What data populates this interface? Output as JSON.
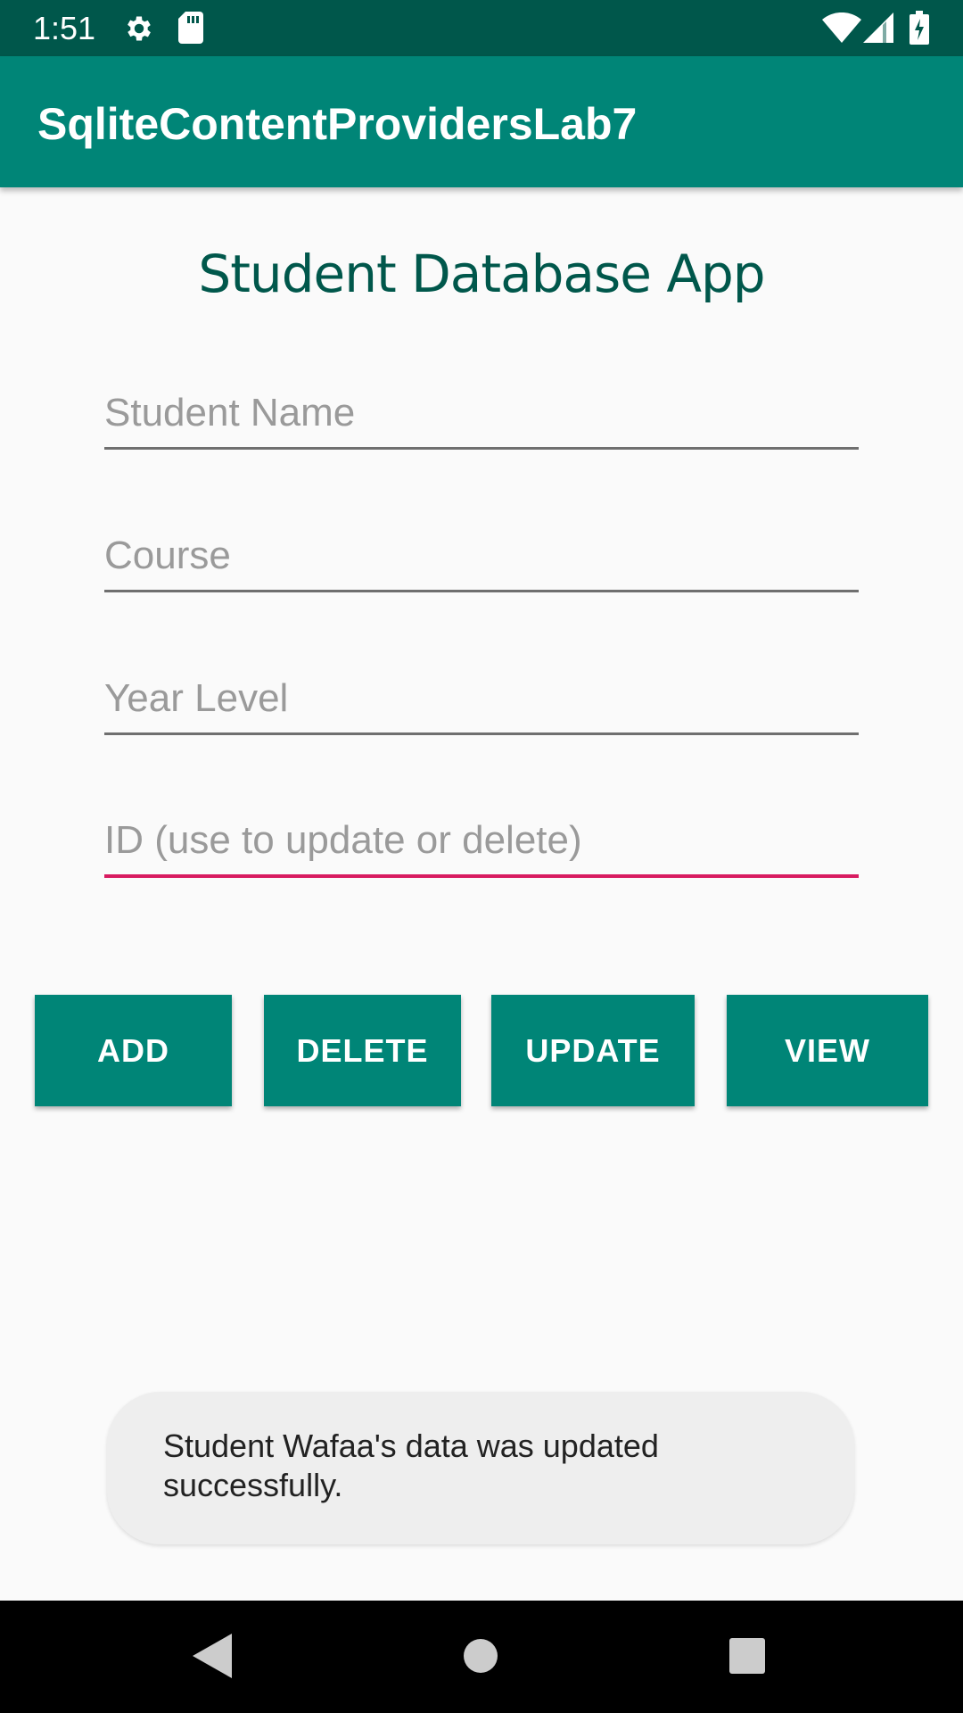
{
  "status_bar": {
    "time": "1:51",
    "icons": [
      "settings-icon",
      "sd-card-icon",
      "wifi-icon",
      "cell-signal-icon",
      "battery-icon"
    ]
  },
  "app_bar": {
    "title": "SqliteContentProvidersLab7"
  },
  "heading": "Student Database App",
  "form": {
    "student_name": {
      "placeholder": "Student Name",
      "value": ""
    },
    "course": {
      "placeholder": "Course",
      "value": ""
    },
    "year_level": {
      "placeholder": "Year Level",
      "value": ""
    },
    "id": {
      "placeholder": "ID (use to update or delete)",
      "value": ""
    }
  },
  "buttons": {
    "add": "ADD",
    "delete": "DELETE",
    "update": "UPDATE",
    "view": "VIEW"
  },
  "toast": {
    "message": "Student Wafaa's data was updated successfully."
  },
  "nav_bar": {
    "icons": [
      "back-icon",
      "home-icon",
      "recents-icon"
    ]
  },
  "colors": {
    "primary": "#008577",
    "primary_dark": "#00574b",
    "accent": "#d81b60",
    "background": "#fafafa",
    "toast_background": "#eeeeee"
  }
}
